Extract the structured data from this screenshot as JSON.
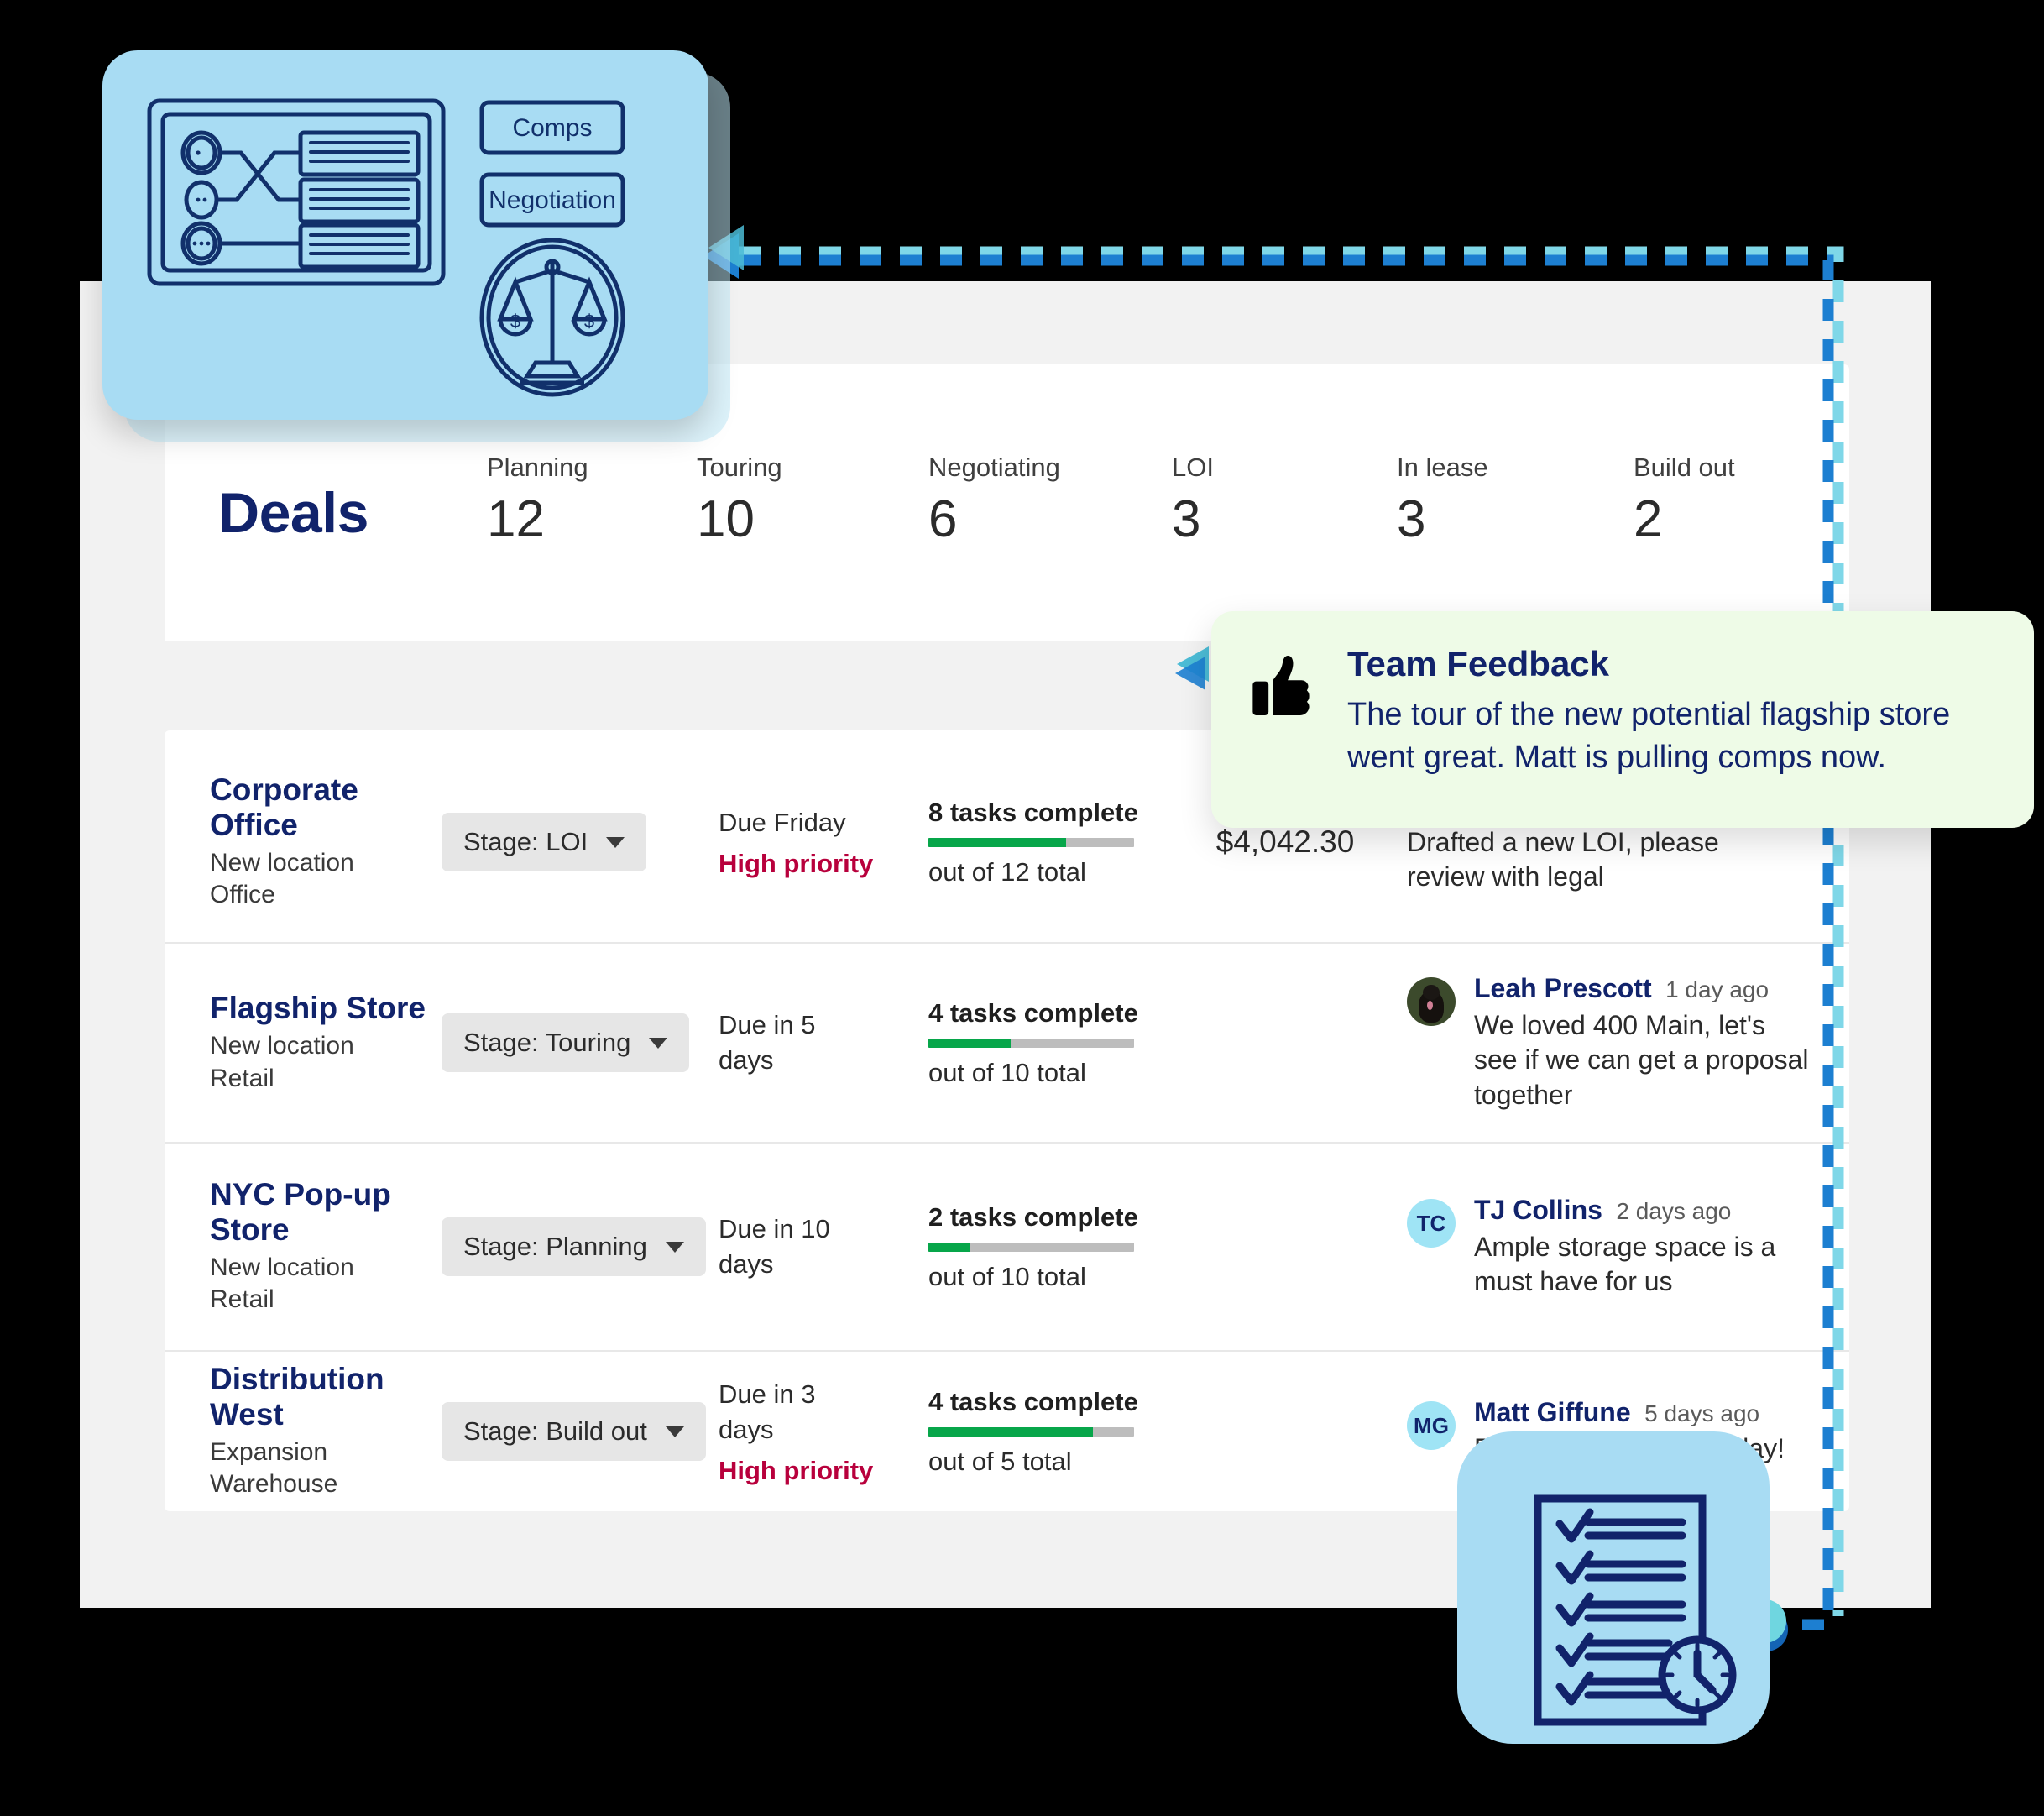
{
  "header": {
    "title": "Deals",
    "stats": [
      {
        "label": "Planning",
        "value": "12"
      },
      {
        "label": "Touring",
        "value": "10"
      },
      {
        "label": "Negotiating",
        "value": "6"
      },
      {
        "label": "LOI",
        "value": "3"
      },
      {
        "label": "In lease",
        "value": "3"
      },
      {
        "label": "Build out",
        "value": "2"
      }
    ]
  },
  "deals": [
    {
      "name": "Corporate Office",
      "type": "New location",
      "category": "Office",
      "stage": "Stage: LOI",
      "due": "Due Friday",
      "priority": "High priority",
      "tasks_complete": "8 tasks complete",
      "tasks_total": "out of 12 total",
      "progress_pct": 67,
      "amount": "$4,042.30",
      "comment_author": "",
      "comment_time": "",
      "comment_text": "Drafted a new LOI, please review with legal"
    },
    {
      "name": "Flagship Store",
      "type": "New location",
      "category": "Retail",
      "stage": "Stage: Touring",
      "due": "Due in 5 days",
      "priority": "",
      "tasks_complete": "4 tasks complete",
      "tasks_total": "out of 10 total",
      "progress_pct": 40,
      "amount": "",
      "comment_author": "Leah Prescott",
      "comment_time": "1 day ago",
      "comment_text": "We loved 400 Main, let's see if we can get a proposal together",
      "avatar_kind": "photo"
    },
    {
      "name": "NYC Pop-up Store",
      "type": "New location",
      "category": "Retail",
      "stage": "Stage: Planning",
      "due": "Due in 10 days",
      "priority": "",
      "tasks_complete": "2 tasks complete",
      "tasks_total": "out of 10 total",
      "progress_pct": 20,
      "amount": "",
      "comment_author": "TJ Collins",
      "comment_time": "2 days ago",
      "comment_text": "Ample storage space is a must have for us",
      "avatar_initials": "TC"
    },
    {
      "name": "Distribution West",
      "type": "Expansion",
      "category": "Warehouse",
      "stage": "Stage: Build out",
      "due": "Due in 3 days",
      "priority": "High priority",
      "tasks_complete": "4 tasks complete",
      "tasks_total": "out of 5 total",
      "progress_pct": 80,
      "amount": "",
      "comment_author": "Matt Giffune",
      "comment_time": "5 days ago",
      "comment_text": "Picking out finishes today!",
      "avatar_initials": "MG"
    }
  ],
  "callout": {
    "icon": "thumbs-up-icon",
    "title": "Team Feedback",
    "text": "The tour of the new potential flagship store went great. Matt is pulling comps now."
  },
  "illustration_card": {
    "chip_1": "Comps",
    "chip_2": "Negotiation",
    "icons": [
      "flowchart-icon",
      "scales-of-justice-icon"
    ]
  },
  "checklist_card": {
    "icons": [
      "checklist-document-icon",
      "clock-icon"
    ]
  },
  "colors": {
    "brand_navy": "#11236b",
    "accent_blue": "#a8dcf3",
    "progress_green": "#07a64a",
    "priority_red": "#b8003c",
    "callout_green": "#eefbe7",
    "connector_blue": "#1d7fd1",
    "connector_teal": "#7fd7e8",
    "page_bg": "#f2f2f2"
  }
}
